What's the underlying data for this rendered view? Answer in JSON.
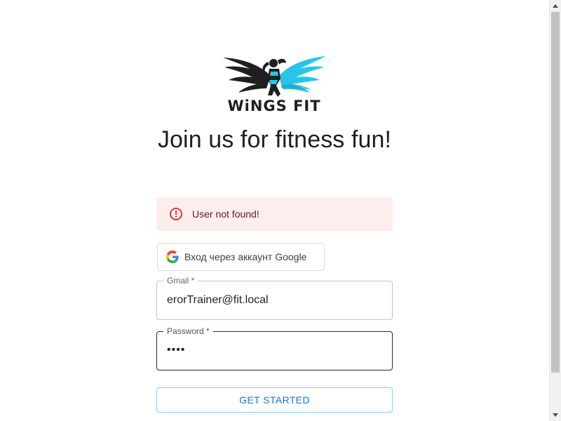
{
  "brand": {
    "logo_text": "WiNGS FIT",
    "accent_color": "#29c5e8",
    "dark_color": "#1f1f1f"
  },
  "headline": "Join us for fitness fun!",
  "alert": {
    "message": "User not found!",
    "icon": "error-outline-icon",
    "severity": "error"
  },
  "google_button": {
    "label": "Вход через аккаунт Google",
    "icon": "google-icon"
  },
  "form": {
    "gmail": {
      "label": "Gmail *",
      "value": "erorTrainer@fit.local"
    },
    "password": {
      "label": "Password *",
      "masked_value": "••••"
    },
    "submit_label": "GET STARTED"
  }
}
